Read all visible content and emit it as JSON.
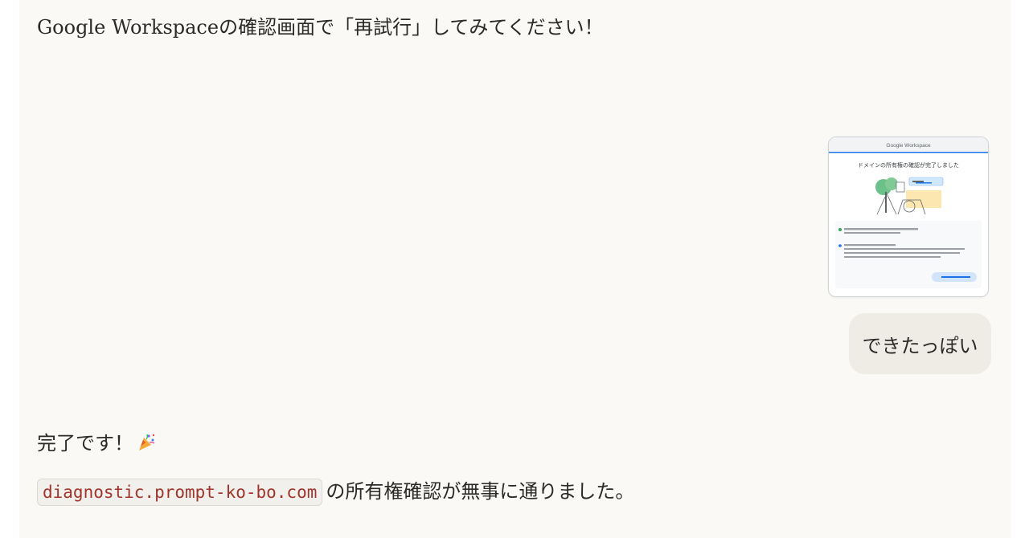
{
  "messages": {
    "assistant_1": "Google Workspaceの確認画面で「再試行」してみてください！",
    "user_reply": "できたっぽい",
    "assistant_2_title": "完了です！",
    "assistant_2_domain": "diagnostic.prompt-ko-bo.com",
    "assistant_2_suffix": "の所有権確認が無事に通りました。"
  },
  "attachment": {
    "header_logo_text": "Google Workspace",
    "heading": "ドメインの所有権の確認が完了しました"
  },
  "icons": {
    "party": "party-popper-icon"
  },
  "colors": {
    "chat_background": "#faf9f6",
    "user_bubble": "#eeece4",
    "code_text": "#a0352c",
    "google_blue": "#1a73e8"
  }
}
